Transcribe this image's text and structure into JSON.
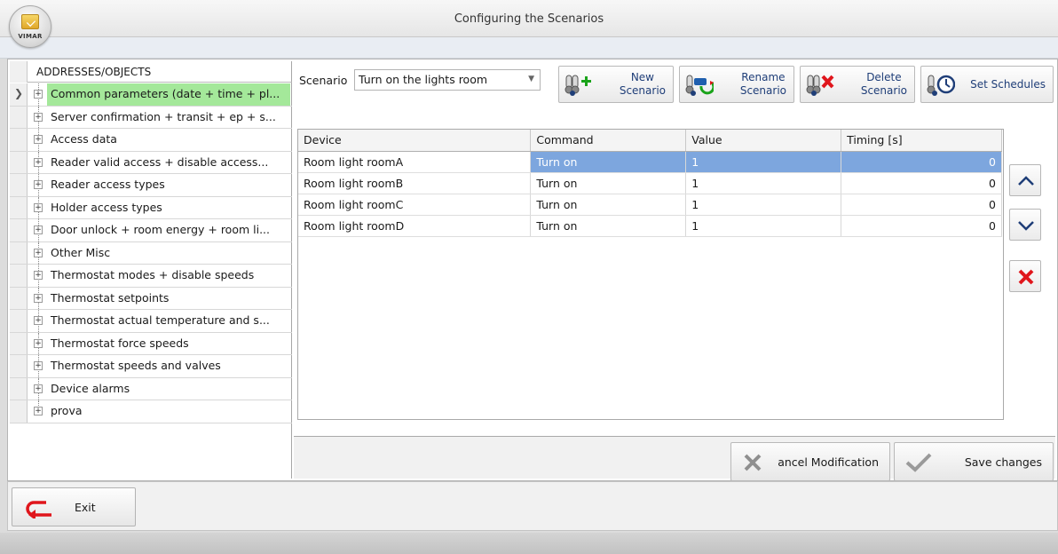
{
  "window": {
    "title": "Configuring the Scenarios",
    "logo_text": "VIMAR"
  },
  "tree": {
    "header": "ADDRESSES/OBJECTS",
    "items": [
      {
        "label": "Common parameters (date + time + pl..."
      },
      {
        "label": "Server confirmation + transit + ep + s..."
      },
      {
        "label": "Access data"
      },
      {
        "label": "Reader valid access + disable access..."
      },
      {
        "label": "Reader access types"
      },
      {
        "label": "Holder access types"
      },
      {
        "label": "Door unlock + room energy + room li..."
      },
      {
        "label": "Other Misc"
      },
      {
        "label": "Thermostat modes + disable speeds"
      },
      {
        "label": "Thermostat setpoints"
      },
      {
        "label": "Thermostat actual temperature and s..."
      },
      {
        "label": "Thermostat force speeds"
      },
      {
        "label": "Thermostat speeds and valves"
      },
      {
        "label": "Device alarms"
      },
      {
        "label": "prova"
      }
    ]
  },
  "scenario": {
    "label": "Scenario",
    "selected": "Turn on the lights room"
  },
  "toolbar": {
    "new_label": "New\nScenario",
    "rename_label": "Rename\nScenario",
    "delete_label": "Delete\nScenario",
    "schedules_label": "Set Schedules"
  },
  "table": {
    "columns": [
      "Device",
      "Command",
      "Value",
      "Timing [s]"
    ],
    "rows": [
      {
        "device": "Room light roomA",
        "command": "Turn on",
        "value": "1",
        "timing": "0"
      },
      {
        "device": "Room light roomB",
        "command": "Turn on",
        "value": "1",
        "timing": "0"
      },
      {
        "device": "Room light roomC",
        "command": "Turn on",
        "value": "1",
        "timing": "0"
      },
      {
        "device": "Room light roomD",
        "command": "Turn on",
        "value": "1",
        "timing": "0"
      }
    ]
  },
  "actions": {
    "cancel_label": "ancel Modification",
    "save_label": "Save changes"
  },
  "footer": {
    "exit_label": "Exit"
  },
  "colors": {
    "tree_selected": "#a4e89a",
    "row_selected": "#7da6de",
    "delete_red": "#e0161c",
    "link_blue": "#1f3e78"
  }
}
